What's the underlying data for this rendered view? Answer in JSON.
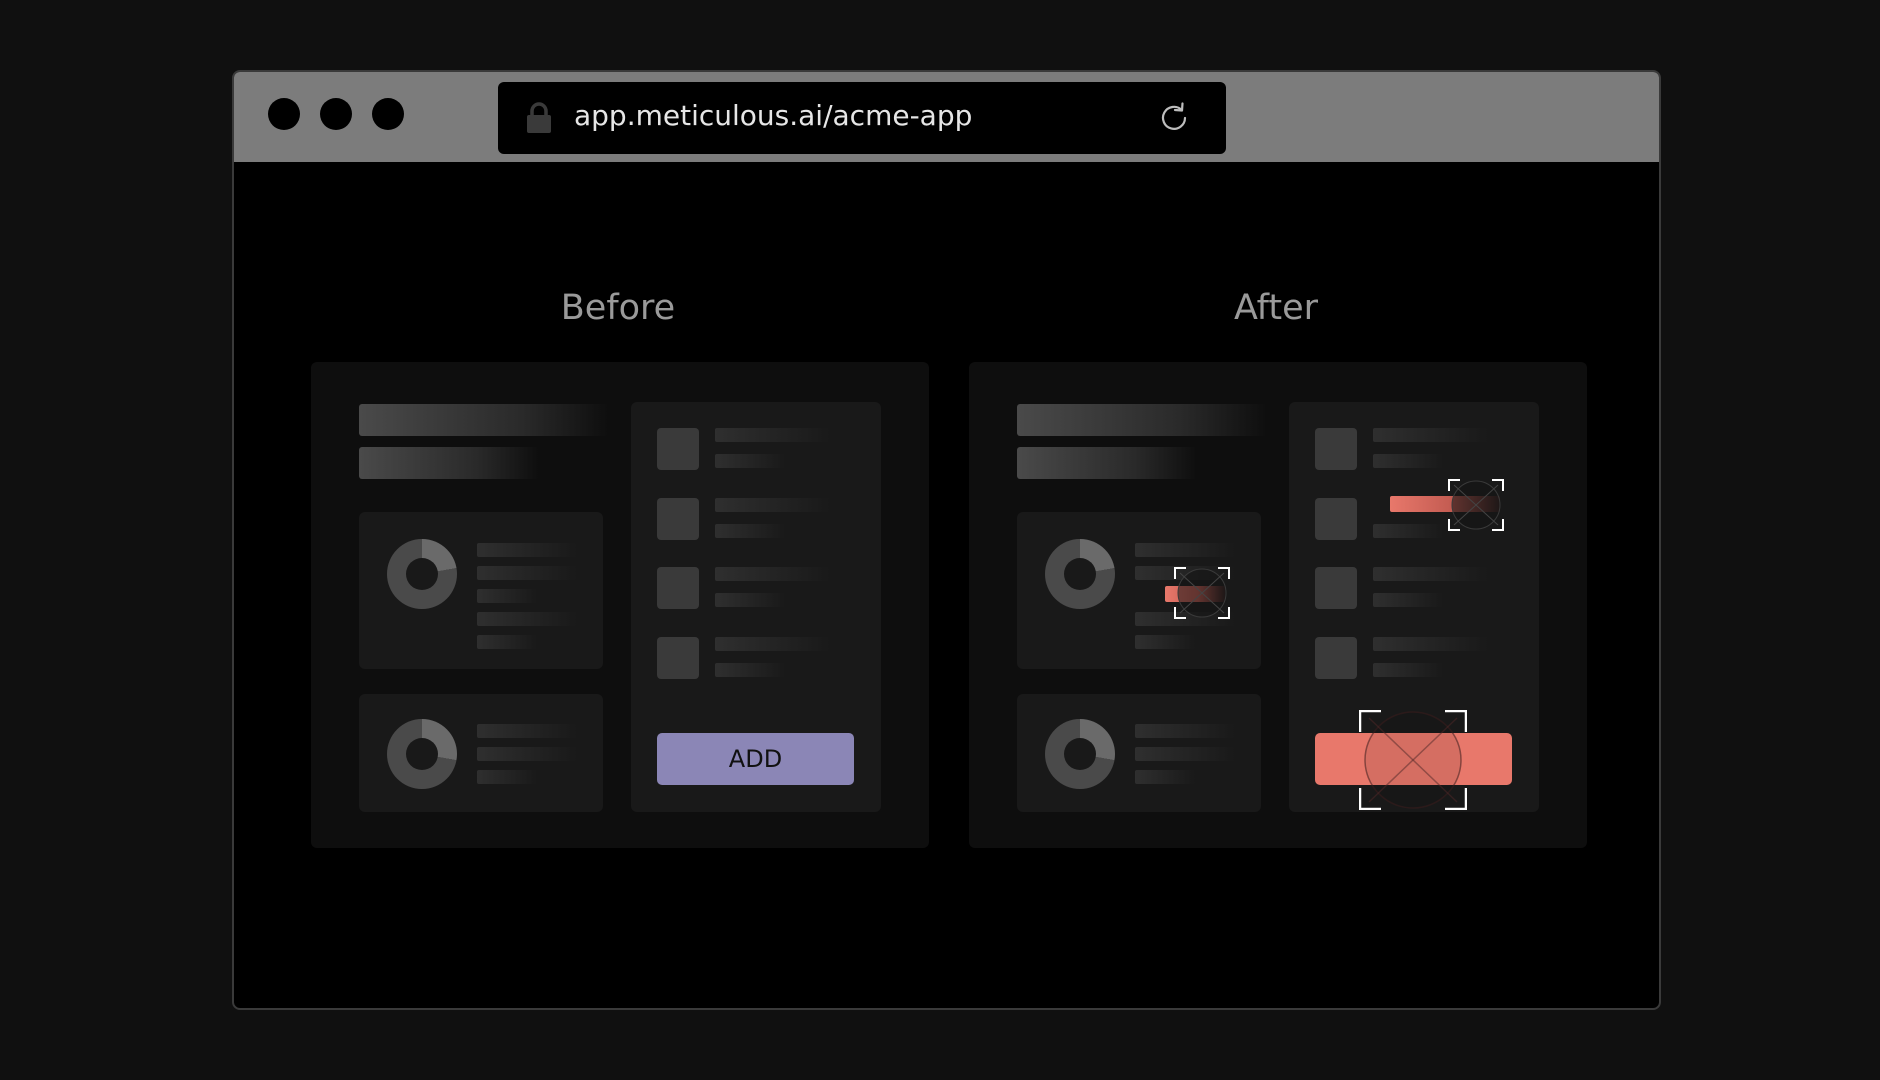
{
  "browser": {
    "url": "app.meticulous.ai/acme-app",
    "chrome_color": "#7c7c7c",
    "icons": [
      "lock-icon",
      "reload-icon"
    ]
  },
  "comparison": {
    "before": {
      "label": "Before",
      "button_label": "ADD",
      "button_color": "#8b86b6"
    },
    "after": {
      "label": "After",
      "diff_color": "#e8786b"
    }
  }
}
